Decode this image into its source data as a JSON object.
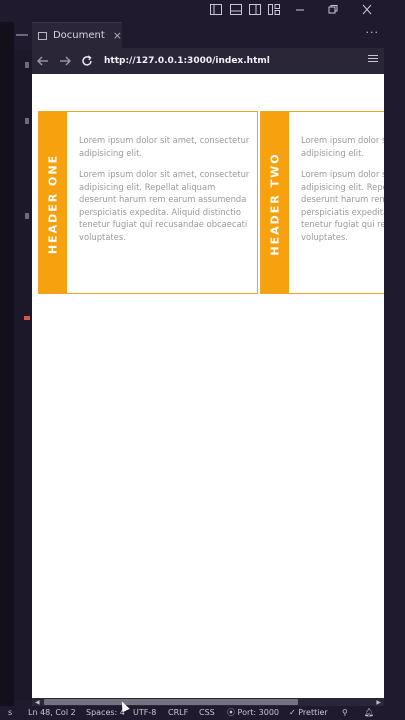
{
  "browser": {
    "tab_title": "Document",
    "tab_close": "×",
    "url": "http://127.0.0.1:3000/index.html",
    "more_dots": "···"
  },
  "cards": [
    {
      "header": "HEADER ONE",
      "paragraph1": "Lorem ipsum dolor sit amet, consectetur adipisicing elit.",
      "paragraph2": "Lorem ipsum dolor sit amet, consectetur adipisicing elit. Repellat aliquam deserunt harum rem earum assumenda perspiciatis expedita. Aliquid distinctio tenetur fugiat qui recusandae obcaecati voluptates."
    },
    {
      "header": "HEADER TWO",
      "paragraph1": "Lorem ipsum dolor sit amet, consectetur adipisicing elit.",
      "paragraph2": "Lorem ipsum dolor sit amet, consectetur adipisicing elit. Repellat aliquam deserunt harum rem earum assumenda perspiciatis expedita. Aliquid distinctio tenetur fugiat qui recusandae obcaecati voluptates."
    }
  ],
  "statusbar": {
    "left_fragment": "s",
    "position": "Ln 48, Col 2",
    "spaces": "Spaces: 4",
    "encoding": "UTF-8",
    "eol": "CRLF",
    "language": "CSS",
    "port": "Port: 3000",
    "prettier": "Prettier"
  },
  "colors": {
    "accent": "#f8a10e",
    "card_border": "#f0a629",
    "editor_bg": "#1f1a2e"
  }
}
